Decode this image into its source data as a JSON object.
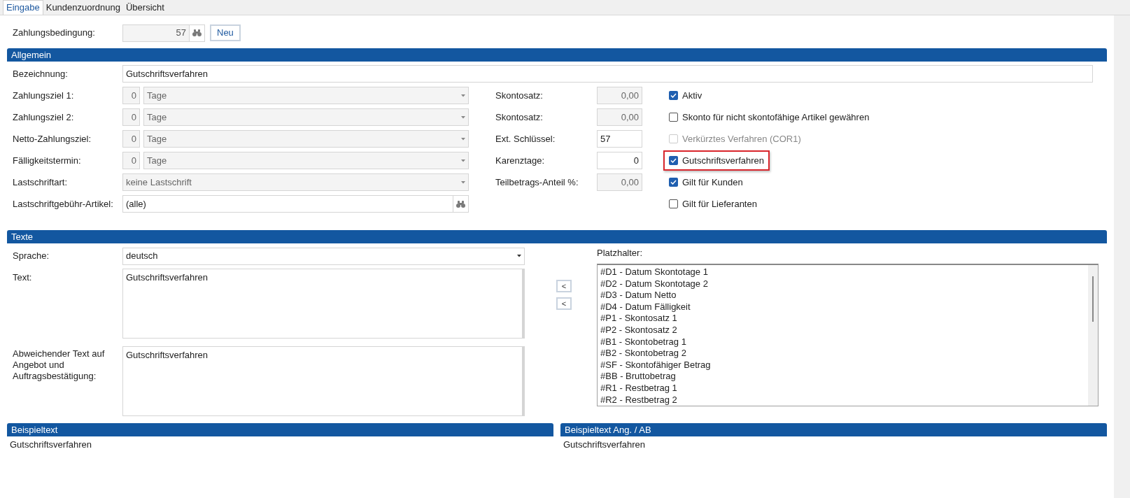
{
  "tabs": [
    {
      "label": "Eingabe",
      "selected": true
    },
    {
      "label": "Kundenzuordnung",
      "selected": false
    },
    {
      "label": "Übersicht",
      "selected": false
    }
  ],
  "header": {
    "label": "Zahlungsbedingung:",
    "value": "57",
    "button": "Neu"
  },
  "allgemein": {
    "title": "Allgemein",
    "bezeichnung": {
      "label": "Bezeichnung:",
      "value": "Gutschriftsverfahren"
    },
    "left_rows": [
      {
        "kind": "days",
        "label": "Zahlungsziel 1:",
        "number": "0",
        "unit": "Tage",
        "disabled": true
      },
      {
        "kind": "days",
        "label": "Zahlungsziel 2:",
        "number": "0",
        "unit": "Tage",
        "disabled": true
      },
      {
        "kind": "days",
        "label": "Netto-Zahlungsziel:",
        "number": "0",
        "unit": "Tage",
        "disabled": true
      },
      {
        "kind": "days",
        "label": "Fälligkeitstermin:",
        "number": "0",
        "unit": "Tage",
        "disabled": true
      },
      {
        "kind": "select",
        "label": "Lastschriftart:",
        "value": "keine Lastschrift",
        "disabled": true
      },
      {
        "kind": "lookup",
        "label": "Lastschriftgebühr-Artikel:",
        "value": "(alle)",
        "disabled": false
      }
    ],
    "middle_rows": [
      {
        "kind": "number",
        "label": "Skontosatz:",
        "value": "0,00",
        "disabled": true
      },
      {
        "kind": "number",
        "label": "Skontosatz:",
        "value": "0,00",
        "disabled": true
      },
      {
        "kind": "text",
        "label": "Ext. Schlüssel:",
        "value": "57",
        "disabled": false
      },
      {
        "kind": "number",
        "label": "Karenztage:",
        "value": "0",
        "disabled": false
      },
      {
        "kind": "number",
        "label": "Teilbetrags-Anteil %:",
        "value": "0,00",
        "disabled": true
      }
    ],
    "checkboxes": [
      {
        "label": "Aktiv",
        "checked": true,
        "disabled": false,
        "highlighted": false
      },
      {
        "label": "Skonto für nicht skontofähige Artikel gewähren",
        "checked": false,
        "disabled": false,
        "highlighted": false
      },
      {
        "label": "Verkürztes Verfahren (COR1)",
        "checked": false,
        "disabled": true,
        "highlighted": false
      },
      {
        "label": "Gutschriftsverfahren",
        "checked": true,
        "disabled": false,
        "highlighted": true
      },
      {
        "label": "Gilt für Kunden",
        "checked": true,
        "disabled": false,
        "highlighted": false
      },
      {
        "label": "Gilt für Lieferanten",
        "checked": false,
        "disabled": false,
        "highlighted": false
      }
    ]
  },
  "texte": {
    "title": "Texte",
    "sprache": {
      "label": "Sprache:",
      "value": "deutsch"
    },
    "text": {
      "label": "Text:",
      "value": "Gutschriftsverfahren"
    },
    "abweichend": {
      "label": "Abweichender Text auf Angebot und Auftragsbestätigung:",
      "value": "Gutschriftsverfahren"
    },
    "arrow_buttons": [
      "<",
      "<"
    ],
    "platzhalter": {
      "label": "Platzhalter:",
      "items": [
        "#D1 - Datum Skontotage 1",
        "#D2 - Datum Skontotage 2",
        "#D3 - Datum Netto",
        "#D4 - Datum Fälligkeit",
        "#P1 - Skontosatz 1",
        "#P2 - Skontosatz 2",
        "#B1 - Skontobetrag 1",
        "#B2 - Skontobetrag 2",
        "#SF - Skontofähiger Betrag",
        "#BB - Bruttobetrag",
        "#R1 - Restbetrag 1",
        "#R2 - Restbetrag 2"
      ]
    }
  },
  "examples": [
    {
      "title": "Beispieltext",
      "text": "Gutschriftsverfahren"
    },
    {
      "title": "Beispieltext Ang. / AB",
      "text": "Gutschriftsverfahren"
    }
  ]
}
